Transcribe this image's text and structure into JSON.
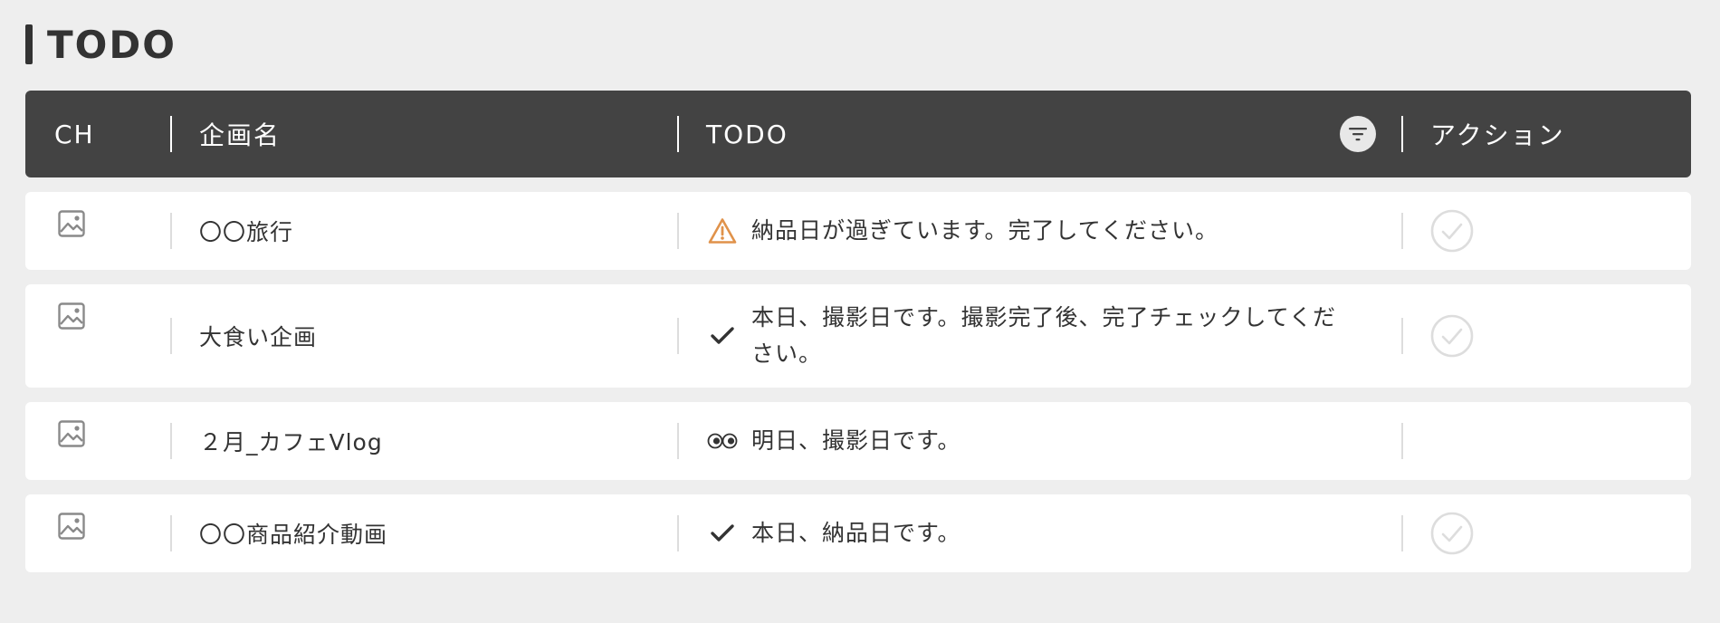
{
  "page": {
    "title": "TODO"
  },
  "table": {
    "headers": {
      "ch": "CH",
      "name": "企画名",
      "todo": "TODO",
      "action": "アクション"
    },
    "rows": [
      {
        "name": "〇〇旅行",
        "todo_icon": "warning-icon",
        "todo": "納品日が過ぎています。完了してください。",
        "has_action": true
      },
      {
        "name": "大食い企画",
        "todo_icon": "check-icon",
        "todo": "本日、撮影日です。撮影完了後、完了チェックしてください。",
        "has_action": true
      },
      {
        "name": "２月_カフェVlog",
        "todo_icon": "eyes-icon",
        "todo": "明日、撮影日です。",
        "has_action": false
      },
      {
        "name": "〇〇商品紹介動画",
        "todo_icon": "check-icon",
        "todo": "本日、納品日です。",
        "has_action": true
      }
    ]
  },
  "colors": {
    "header_bg": "#434343",
    "page_bg": "#eeeeee",
    "warning": "#e0924a",
    "action_circle": "#dddddd"
  }
}
